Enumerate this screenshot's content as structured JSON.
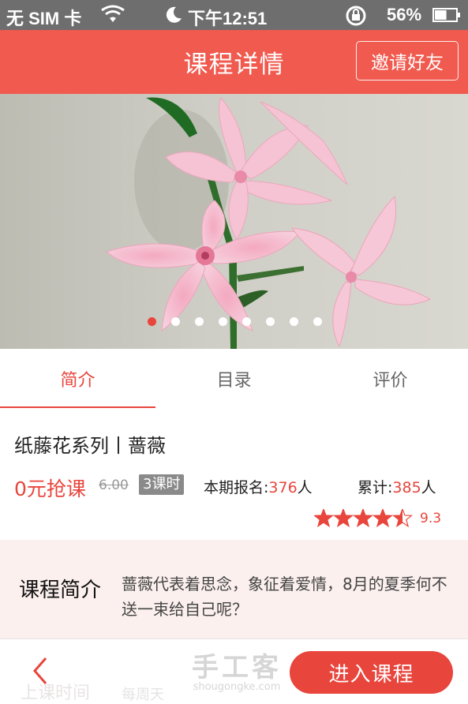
{
  "status_bar": {
    "carrier": "无 SIM 卡",
    "time": "下午12:51",
    "battery_percent": "56%",
    "battery_level": 0.56,
    "icons": [
      "wifi-icon",
      "moon-icon",
      "rotation-lock-icon",
      "battery-icon"
    ]
  },
  "nav": {
    "title": "课程详情",
    "invite_label": "邀请好友"
  },
  "carousel": {
    "dot_count": 8,
    "active_index": 0
  },
  "tabs": [
    {
      "label": "简介",
      "active": true
    },
    {
      "label": "目录",
      "active": false
    },
    {
      "label": "评价",
      "active": false
    }
  ],
  "course": {
    "title": "纸藤花系列丨蔷薇",
    "price": "0元抢课",
    "original_price": "6.00",
    "lessons": "3课时",
    "enroll_label": "本期报名:",
    "enroll_count": "376",
    "enroll_unit": "人",
    "total_label": "累计:",
    "total_count": "385",
    "total_unit": "人",
    "rating": 4.5,
    "score": "9.3"
  },
  "intro": {
    "label": "课程简介",
    "text": "蔷薇代表着思念，象征着爱情，8月的夏季何不送一束给自己呢？"
  },
  "bottom": {
    "schedule_label": "上课时间",
    "schedule_value": "每周天",
    "watermark_main": "手工客",
    "watermark_sub": "shougongke.com",
    "enter_label": "进入课程"
  },
  "colors": {
    "accent": "#e8453c",
    "nav_bg": "#f05a4f",
    "status_bg": "#6e6e6e",
    "intro_bg": "#fbf0ee"
  }
}
